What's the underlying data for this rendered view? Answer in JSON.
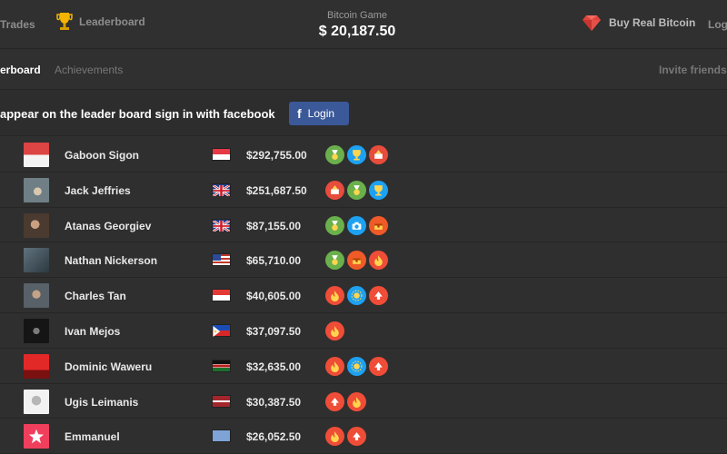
{
  "topbar": {
    "trades_label": "Trades",
    "leaderboard_label": "Leaderboard",
    "game_title": "Bitcoin Game",
    "balance": "$ 20,187.50",
    "buy_real_label": "Buy Real Bitcoin",
    "logout_label": "Log"
  },
  "tabs": {
    "active_label": "erboard",
    "inactive_label": "Achievements",
    "invite_label": "Invite friends"
  },
  "facebook": {
    "prompt": "appear on the leader board sign in with facebook",
    "button_label": "Login"
  },
  "players": [
    {
      "name": "Gaboon Sigon",
      "flag": "indonesia",
      "amount": "$292,755.00",
      "badges": [
        "green",
        "blue",
        "red"
      ]
    },
    {
      "name": "Jack Jeffries",
      "flag": "uk",
      "amount": "$251,687.50",
      "badges": [
        "red",
        "green",
        "blue"
      ]
    },
    {
      "name": "Atanas Georgiev",
      "flag": "uk",
      "amount": "$87,155.00",
      "badges": [
        "green",
        "blue",
        "orange"
      ]
    },
    {
      "name": "Nathan Nickerson",
      "flag": "us",
      "amount": "$65,710.00",
      "badges": [
        "green",
        "orange",
        "fire"
      ]
    },
    {
      "name": "Charles Tan",
      "flag": "singapore",
      "amount": "$40,605.00",
      "badges": [
        "fire",
        "blue",
        "fire"
      ]
    },
    {
      "name": "Ivan Mejos",
      "flag": "philippines",
      "amount": "$37,097.50",
      "badges": [
        "fire"
      ]
    },
    {
      "name": "Dominic Waweru",
      "flag": "kenya",
      "amount": "$32,635.00",
      "badges": [
        "fire",
        "blue",
        "fire"
      ]
    },
    {
      "name": "Ugis Leimanis",
      "flag": "latvia",
      "amount": "$30,387.50",
      "badges": [
        "fire",
        "fire"
      ]
    },
    {
      "name": "Emmanuel",
      "flag": "blank",
      "amount": "$26,052.50",
      "badges": [
        "fire",
        "fire"
      ]
    }
  ],
  "icons": {
    "trophy": "trophy-icon",
    "gem": "ruby-gem-icon",
    "facebook": "facebook-icon",
    "avatar": "avatar-icon"
  },
  "colors": {
    "background": "#2f2f2f",
    "facebook_blue": "#3b5998",
    "gem_red": "#e0443c"
  }
}
